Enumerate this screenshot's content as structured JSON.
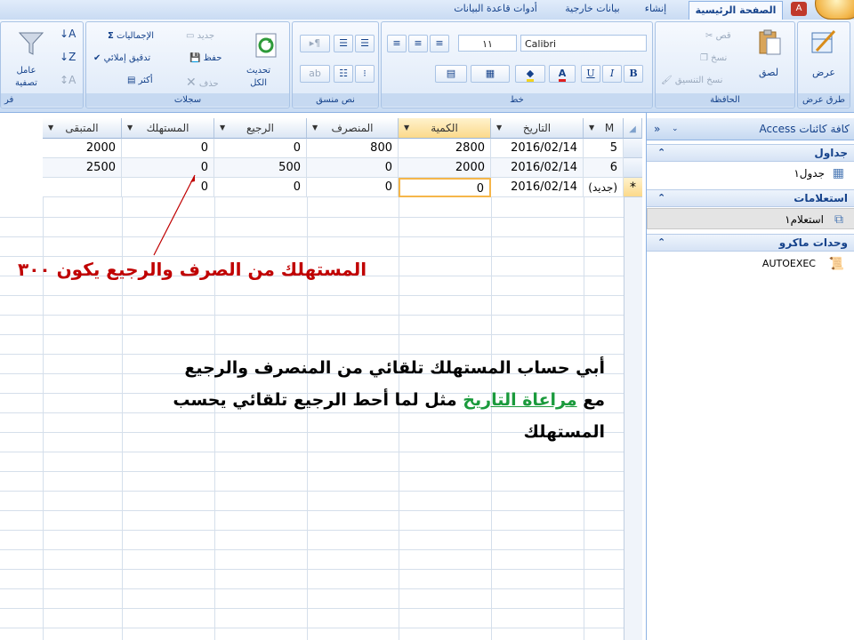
{
  "ribbon_tabs": [
    "الصفحة الرئيسية",
    "إنشاء",
    "بيانات خارجية",
    "أدوات قاعدة البيانات"
  ],
  "groups": {
    "views": {
      "title": "طرق عرض",
      "view": "عرض"
    },
    "clipboard": {
      "title": "الحافظة",
      "paste": "لصق",
      "cut": "قص",
      "copy": "نسخ",
      "format_painter": "نسخ التنسيق"
    },
    "font": {
      "title": "خط",
      "font_name": "Calibri",
      "font_size": "١١",
      "bold": "B",
      "italic": "I",
      "underline": "U"
    },
    "rich_text": {
      "title": "نص منسق"
    },
    "records": {
      "title": "سجلات",
      "refresh": "تحديث",
      "refresh_all": "الكل",
      "new": "جديد",
      "save": "حفظ",
      "delete": "حذف",
      "totals": "الإجماليات",
      "spelling": "تدقيق إملائي",
      "more": "أكثر"
    },
    "sort_filter": {
      "title": "فر",
      "filter": "عامل",
      "filter2": "تصفية"
    }
  },
  "table": {
    "columns": [
      "M",
      "التاريخ",
      "الكمية",
      "المنصرف",
      "الرجيع",
      "المستهلك",
      "المتبقى"
    ],
    "rows": [
      {
        "M": "5",
        "date": "2016/02/14",
        "qty": "2800",
        "out": "800",
        "ret": "0",
        "cons": "0",
        "rem": "2000"
      },
      {
        "M": "6",
        "date": "2016/02/14",
        "qty": "2000",
        "out": "0",
        "ret": "500",
        "cons": "0",
        "rem": "2500"
      },
      {
        "M": "(جديد)",
        "date": "2016/02/14",
        "qty": "0",
        "out": "0",
        "ret": "0",
        "cons": "0",
        "rem": ""
      }
    ],
    "new_marker": "*"
  },
  "annotations": {
    "red": "المستهلك من الصرف والرجيع يكون ٣٠٠",
    "line1": "أبي حساب المستهلك تلقائي من المنصرف والرجيع",
    "line2_prefix": "مع ",
    "line2_link": "مراعاة التاريخ",
    "line2_suffix": " مثل لما أحط الرجيع تلقائي يحسب",
    "line3": "المستهلك"
  },
  "nav": {
    "header": "كافة كائنات Access",
    "groups": [
      {
        "title": "جداول",
        "items": [
          "جدول١"
        ]
      },
      {
        "title": "استعلامات",
        "items": [
          "استعلام١"
        ]
      },
      {
        "title": "وحدات ماكرو",
        "items": [
          "AUTOEXEC"
        ]
      }
    ]
  },
  "colors": {
    "accent": "#15428b",
    "ribbon": "#dbe7f7",
    "selection": "#fbd98a",
    "annotation_red": "#c00000",
    "annotation_green": "#1a9a3c"
  }
}
